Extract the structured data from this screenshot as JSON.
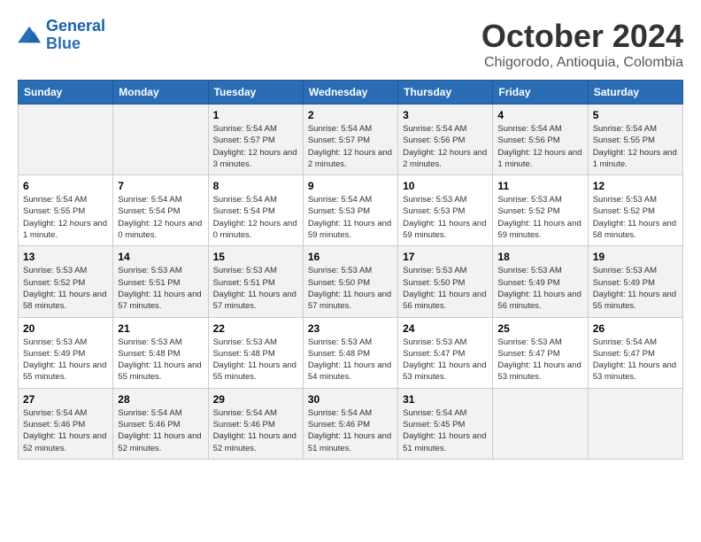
{
  "header": {
    "logo_line1": "General",
    "logo_line2": "Blue",
    "month": "October 2024",
    "location": "Chigorodo, Antioquia, Colombia"
  },
  "days_of_week": [
    "Sunday",
    "Monday",
    "Tuesday",
    "Wednesday",
    "Thursday",
    "Friday",
    "Saturday"
  ],
  "weeks": [
    [
      {
        "num": "",
        "info": ""
      },
      {
        "num": "",
        "info": ""
      },
      {
        "num": "1",
        "info": "Sunrise: 5:54 AM\nSunset: 5:57 PM\nDaylight: 12 hours and 3 minutes."
      },
      {
        "num": "2",
        "info": "Sunrise: 5:54 AM\nSunset: 5:57 PM\nDaylight: 12 hours and 2 minutes."
      },
      {
        "num": "3",
        "info": "Sunrise: 5:54 AM\nSunset: 5:56 PM\nDaylight: 12 hours and 2 minutes."
      },
      {
        "num": "4",
        "info": "Sunrise: 5:54 AM\nSunset: 5:56 PM\nDaylight: 12 hours and 1 minute."
      },
      {
        "num": "5",
        "info": "Sunrise: 5:54 AM\nSunset: 5:55 PM\nDaylight: 12 hours and 1 minute."
      }
    ],
    [
      {
        "num": "6",
        "info": "Sunrise: 5:54 AM\nSunset: 5:55 PM\nDaylight: 12 hours and 1 minute."
      },
      {
        "num": "7",
        "info": "Sunrise: 5:54 AM\nSunset: 5:54 PM\nDaylight: 12 hours and 0 minutes."
      },
      {
        "num": "8",
        "info": "Sunrise: 5:54 AM\nSunset: 5:54 PM\nDaylight: 12 hours and 0 minutes."
      },
      {
        "num": "9",
        "info": "Sunrise: 5:54 AM\nSunset: 5:53 PM\nDaylight: 11 hours and 59 minutes."
      },
      {
        "num": "10",
        "info": "Sunrise: 5:53 AM\nSunset: 5:53 PM\nDaylight: 11 hours and 59 minutes."
      },
      {
        "num": "11",
        "info": "Sunrise: 5:53 AM\nSunset: 5:52 PM\nDaylight: 11 hours and 59 minutes."
      },
      {
        "num": "12",
        "info": "Sunrise: 5:53 AM\nSunset: 5:52 PM\nDaylight: 11 hours and 58 minutes."
      }
    ],
    [
      {
        "num": "13",
        "info": "Sunrise: 5:53 AM\nSunset: 5:52 PM\nDaylight: 11 hours and 58 minutes."
      },
      {
        "num": "14",
        "info": "Sunrise: 5:53 AM\nSunset: 5:51 PM\nDaylight: 11 hours and 57 minutes."
      },
      {
        "num": "15",
        "info": "Sunrise: 5:53 AM\nSunset: 5:51 PM\nDaylight: 11 hours and 57 minutes."
      },
      {
        "num": "16",
        "info": "Sunrise: 5:53 AM\nSunset: 5:50 PM\nDaylight: 11 hours and 57 minutes."
      },
      {
        "num": "17",
        "info": "Sunrise: 5:53 AM\nSunset: 5:50 PM\nDaylight: 11 hours and 56 minutes."
      },
      {
        "num": "18",
        "info": "Sunrise: 5:53 AM\nSunset: 5:49 PM\nDaylight: 11 hours and 56 minutes."
      },
      {
        "num": "19",
        "info": "Sunrise: 5:53 AM\nSunset: 5:49 PM\nDaylight: 11 hours and 55 minutes."
      }
    ],
    [
      {
        "num": "20",
        "info": "Sunrise: 5:53 AM\nSunset: 5:49 PM\nDaylight: 11 hours and 55 minutes."
      },
      {
        "num": "21",
        "info": "Sunrise: 5:53 AM\nSunset: 5:48 PM\nDaylight: 11 hours and 55 minutes."
      },
      {
        "num": "22",
        "info": "Sunrise: 5:53 AM\nSunset: 5:48 PM\nDaylight: 11 hours and 55 minutes."
      },
      {
        "num": "23",
        "info": "Sunrise: 5:53 AM\nSunset: 5:48 PM\nDaylight: 11 hours and 54 minutes."
      },
      {
        "num": "24",
        "info": "Sunrise: 5:53 AM\nSunset: 5:47 PM\nDaylight: 11 hours and 53 minutes."
      },
      {
        "num": "25",
        "info": "Sunrise: 5:53 AM\nSunset: 5:47 PM\nDaylight: 11 hours and 53 minutes."
      },
      {
        "num": "26",
        "info": "Sunrise: 5:54 AM\nSunset: 5:47 PM\nDaylight: 11 hours and 53 minutes."
      }
    ],
    [
      {
        "num": "27",
        "info": "Sunrise: 5:54 AM\nSunset: 5:46 PM\nDaylight: 11 hours and 52 minutes."
      },
      {
        "num": "28",
        "info": "Sunrise: 5:54 AM\nSunset: 5:46 PM\nDaylight: 11 hours and 52 minutes."
      },
      {
        "num": "29",
        "info": "Sunrise: 5:54 AM\nSunset: 5:46 PM\nDaylight: 11 hours and 52 minutes."
      },
      {
        "num": "30",
        "info": "Sunrise: 5:54 AM\nSunset: 5:46 PM\nDaylight: 11 hours and 51 minutes."
      },
      {
        "num": "31",
        "info": "Sunrise: 5:54 AM\nSunset: 5:45 PM\nDaylight: 11 hours and 51 minutes."
      },
      {
        "num": "",
        "info": ""
      },
      {
        "num": "",
        "info": ""
      }
    ]
  ]
}
